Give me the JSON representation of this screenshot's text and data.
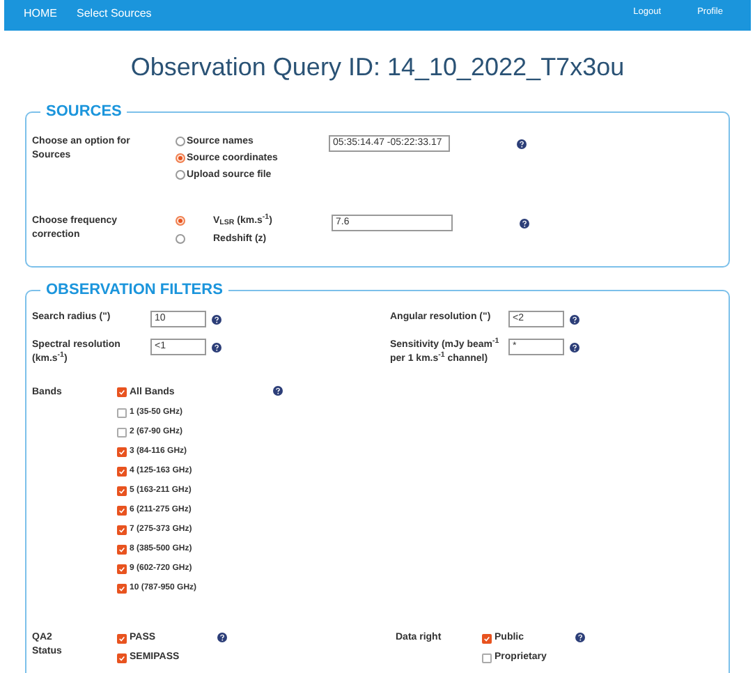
{
  "nav": {
    "left": [
      "HOME",
      "Select Sources"
    ],
    "right": [
      "Logout",
      "Profile"
    ]
  },
  "title": "Observation Query ID: 14_10_2022_T7x3ou",
  "sources": {
    "legend": "SOURCES",
    "option": {
      "label": "Choose an option for Sources",
      "choices": [
        {
          "label": "Source names",
          "selected": false
        },
        {
          "label": "Source coordinates",
          "selected": true
        },
        {
          "label": "Upload source file",
          "selected": false
        }
      ],
      "value": "05:35:14.47 -05:22:33.17"
    },
    "frequency": {
      "label": "Choose frequency correction",
      "choices": [
        {
          "label": "V$_{LSR}$ (km.s$^{-1}$)",
          "selected": true
        },
        {
          "label": "Redshift (z)",
          "selected": false
        }
      ],
      "value": "7.6"
    }
  },
  "filters": {
    "legend": "OBSERVATION FILTERS",
    "fields": [
      {
        "label": "Search radius (\")",
        "value": "10"
      },
      {
        "label": "Angular resolution (\")",
        "value": "<2"
      },
      {
        "label": "Spectral resolution (km.s$^{-1}$)",
        "value": "<1"
      },
      {
        "label": "Sensitivity (mJy beam$^{-1}$ per 1 km.s$^{-1}$ channel)",
        "value": "*"
      }
    ],
    "bands": {
      "label": "Bands",
      "items": [
        {
          "label": "All Bands",
          "checked": true,
          "bold": true
        },
        {
          "label": "1 (35-50 GHz)",
          "checked": false,
          "bold": false
        },
        {
          "label": "2 (67-90 GHz)",
          "checked": false,
          "bold": false
        },
        {
          "label": "3 (84-116 GHz)",
          "checked": true,
          "bold": false
        },
        {
          "label": "4 (125-163 GHz)",
          "checked": true,
          "bold": false
        },
        {
          "label": "5 (163-211 GHz)",
          "checked": true,
          "bold": false
        },
        {
          "label": "6 (211-275 GHz)",
          "checked": true,
          "bold": false
        },
        {
          "label": "7 (275-373 GHz)",
          "checked": true,
          "bold": false
        },
        {
          "label": "8 (385-500 GHz)",
          "checked": true,
          "bold": false
        },
        {
          "label": "9 (602-720 GHz)",
          "checked": true,
          "bold": false
        },
        {
          "label": "10 (787-950 GHz)",
          "checked": true,
          "bold": false
        }
      ]
    },
    "qa2": {
      "label": "QA2 Status",
      "items": [
        {
          "label": "PASS",
          "checked": true
        },
        {
          "label": "SEMIPASS",
          "checked": true
        }
      ]
    },
    "data_right": {
      "label": "Data right",
      "items": [
        {
          "label": "Public",
          "checked": true
        },
        {
          "label": "Proprietary",
          "checked": false
        }
      ]
    }
  }
}
